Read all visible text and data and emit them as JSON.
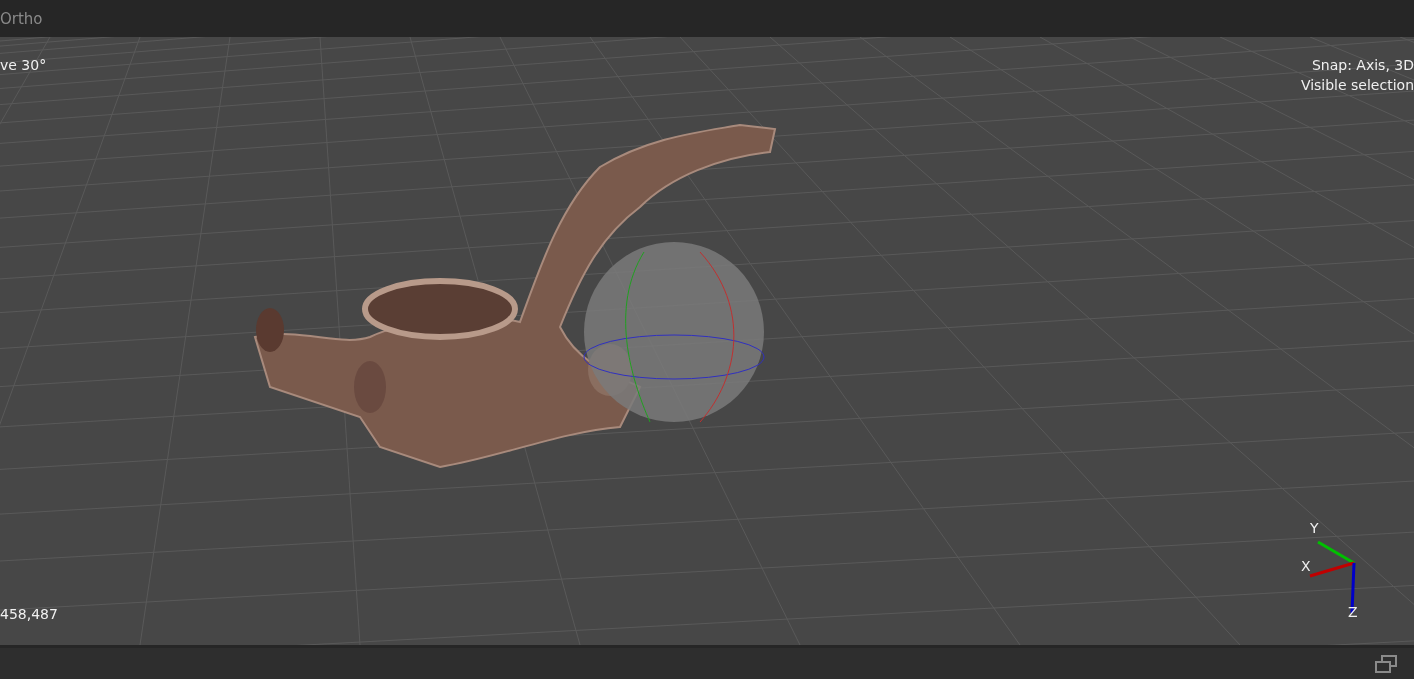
{
  "top_bar": {
    "view_mode": "Ortho"
  },
  "viewport": {
    "projection": "ve 30°",
    "snap": "Snap: Axis, 3D",
    "selection": "Visible selection",
    "point_count": "458,487",
    "axes": [
      {
        "label": "Y",
        "color": "#00c000"
      },
      {
        "label": "X",
        "color": "#c00000"
      },
      {
        "label": "Z",
        "color": "#0000c8"
      }
    ]
  }
}
